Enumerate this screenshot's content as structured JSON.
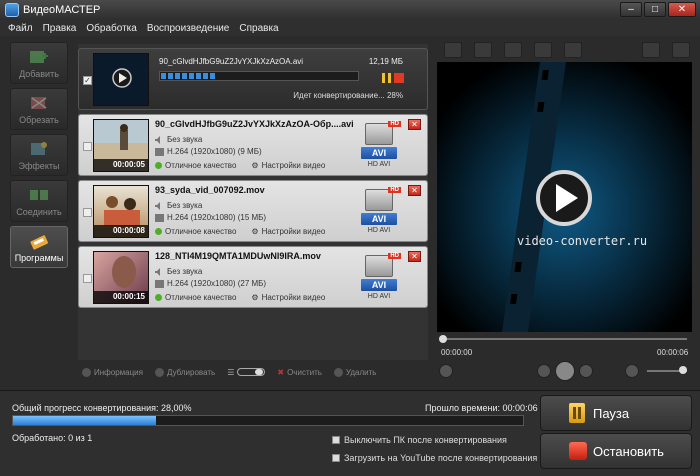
{
  "window": {
    "title": "ВидеоМАСТЕР",
    "min": "–",
    "max": "□",
    "close": "✕"
  },
  "menu": [
    "Файл",
    "Правка",
    "Обработка",
    "Воспроизведение",
    "Справка"
  ],
  "sidebar": [
    {
      "label": "Добавить",
      "icon": "add-film-icon",
      "active": false
    },
    {
      "label": "Обрезать",
      "icon": "cut-icon",
      "active": false
    },
    {
      "label": "Эффекты",
      "icon": "effects-icon",
      "active": false
    },
    {
      "label": "Соединить",
      "icon": "join-icon",
      "active": false
    },
    {
      "label": "Программы",
      "icon": "programs-icon",
      "active": true
    }
  ],
  "converting": {
    "filename": "90_cGlvdHJfbG9uZ2JvYXJkXzAzOA.avi",
    "size": "12,19 МБ",
    "status": "Идет конвертирование... 28%",
    "progress": 0.28
  },
  "files": [
    {
      "name": "90_cGlvdHJfbG9uZ2JvYXJkXzAzOA-Обр....avi",
      "duration": "00:00:05",
      "sound": "Без звука",
      "codec": "H.264 (1920x1080) (9 МБ)",
      "quality": "Отличное качество",
      "settings": "Настройки видео",
      "format": "AVI",
      "format_label": "HD AVI",
      "hd": "HD"
    },
    {
      "name": "93_syda_vid_007092.mov",
      "duration": "00:00:08",
      "sound": "Без звука",
      "codec": "H.264 (1920x1080) (15 МБ)",
      "quality": "Отличное качество",
      "settings": "Настройки видео",
      "format": "AVI",
      "format_label": "HD AVI",
      "hd": "HD"
    },
    {
      "name": "128_NTI4M19QMTA1MDUwNl9IRA.mov",
      "duration": "00:00:15",
      "sound": "Без звука",
      "codec": "H.264 (1920x1080) (27 МБ)",
      "quality": "Отличное качество",
      "settings": "Настройки видео",
      "format": "AVI",
      "format_label": "HD AVI",
      "hd": "HD"
    }
  ],
  "list_toolbar": {
    "info": "Информация",
    "duplicate": "Дублировать",
    "clear": "Очистить",
    "delete": "Удалить"
  },
  "preview": {
    "watermark": "video-converter.ru",
    "time_current": "00:00:00",
    "time_total": "00:00:06",
    "seek": 0.0,
    "volume": 0.8
  },
  "bottom": {
    "total_label": "Общий прогресс конвертирования: 28,00%",
    "total_progress": 0.28,
    "elapsed": "Прошло времени: 00:00:06",
    "done": "Обработано: 0 из 1",
    "opt_shutdown": "Выключить ПК после конвертирования",
    "opt_youtube": "Загрузить на YouTube после конвертирования",
    "pause": "Пауза",
    "stop": "Остановить"
  }
}
